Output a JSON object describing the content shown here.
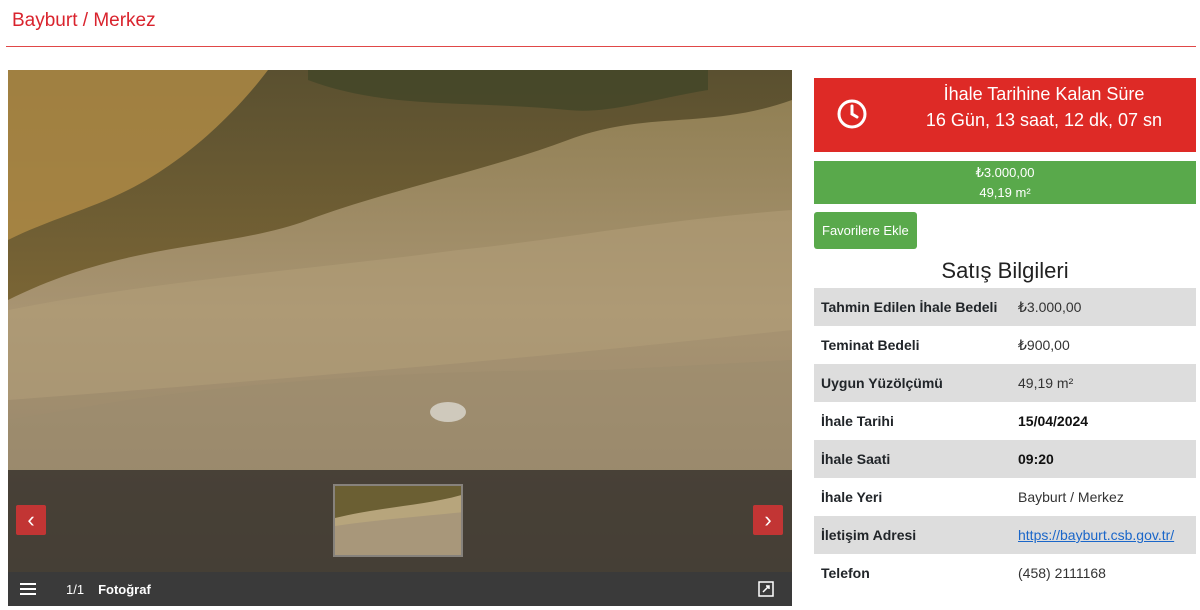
{
  "header": {
    "location": "Bayburt / Merkez"
  },
  "gallery": {
    "prev_icon": "chevron-left-icon",
    "next_icon": "chevron-right-icon",
    "counter": "1/1",
    "label": "Fotoğraf",
    "list_icon": "list-icon",
    "expand_icon": "expand-icon"
  },
  "countdown": {
    "label": "İhale Tarihine Kalan Süre",
    "value": "16 Gün, 13 saat, 12 dk, 07 sn",
    "icon": "clock-icon"
  },
  "price": {
    "amount": "₺3.000,00",
    "area": "49,19 m²"
  },
  "favorites_button": "Favorilere Ekle",
  "sale_info": {
    "title": "Satış Bilgileri",
    "rows": [
      {
        "key": "Tahmin Edilen İhale Bedeli",
        "value": "₺3.000,00"
      },
      {
        "key": "Teminat Bedeli",
        "value": "₺900,00"
      },
      {
        "key": "Uygun Yüzölçümü",
        "value": "49,19 m²"
      },
      {
        "key": "İhale Tarihi",
        "value": "15/04/2024"
      },
      {
        "key": "İhale Saati",
        "value": "09:20"
      },
      {
        "key": "İhale Yeri",
        "value": "Bayburt / Merkez"
      },
      {
        "key": "İletişim Adresi",
        "value": "https://bayburt.csb.gov.tr/"
      },
      {
        "key": "Telefon",
        "value": "(458) 2111168"
      }
    ]
  },
  "colors": {
    "accent_red": "#de2a26",
    "green": "#59a94b",
    "link": "#1a66c9"
  }
}
